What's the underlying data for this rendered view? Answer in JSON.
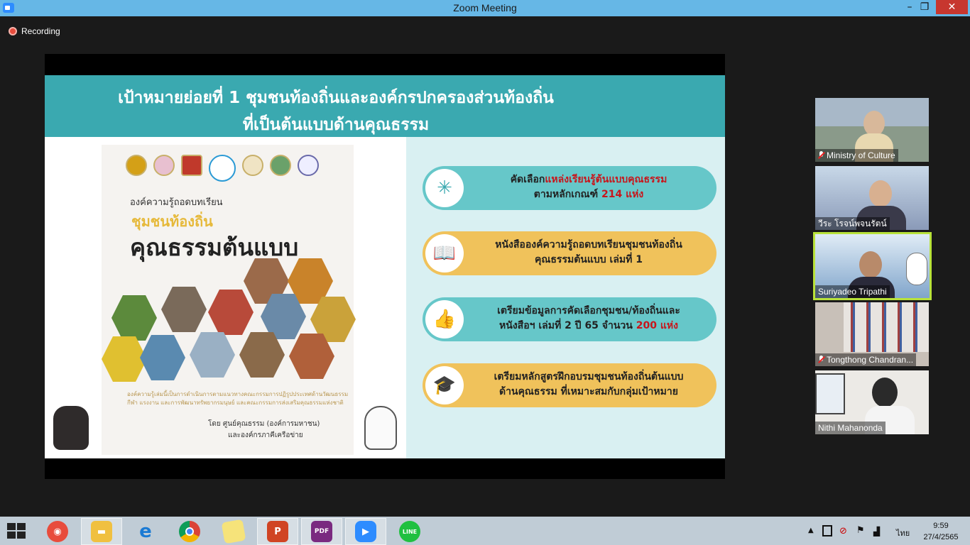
{
  "window": {
    "title": "Zoom Meeting",
    "minimize": "–",
    "maximize": "❐",
    "close": "✕"
  },
  "recording": {
    "label": "Recording"
  },
  "slide": {
    "title_line1": "เป้าหมายย่อยที่ 1 ชุมชนท้องถิ่นและองค์กรปกครองส่วนท้องถิ่น",
    "title_line2": "ที่เป็นต้นแบบด้านคุณธรรม",
    "book": {
      "kicker": "องค์ความรู้ถอดบทเรียน",
      "subtitle": "ชุมชนท้องถิ่น",
      "title": "คุณธรรมต้นแบบ",
      "footnote": "องค์ความรู้เล่มนี้เป็นการดำเนินการตามแนวทางคณะกรรมการปฏิรูปประเทศด้านวัฒนธรรม กีฬา แรงงาน และการพัฒนาทรัพยากรมนุษย์ และคณะกรรมการส่งเสริมคุณธรรมแห่งชาติ",
      "by_line1": "โดย ศูนย์คุณธรรม (องค์การมหาชน)",
      "by_line2": "และองค์กรภาคีเครือข่าย"
    },
    "items": [
      {
        "icon": "network-icon",
        "line1_pre": "คัดเลือก",
        "line1_red": "แหล่งเรียนรู้ต้นแบบคุณธรรม",
        "line2_pre": "ตามหลักเกณฑ์ ",
        "line2_red": "214 แห่ง"
      },
      {
        "icon": "book-icon",
        "line1": "หนังสือองค์ความรู้ถอดบทเรียนชุมชนท้องถิ่น",
        "line2": "คุณธรรมต้นแบบ เล่มที่ 1"
      },
      {
        "icon": "thumbs-up-icon",
        "line1": "เตรียมข้อมูลการคัดเลือกชุมชน/ท้องถิ่นและ",
        "line2_pre": "หนังสือฯ เล่มที่ 2 ปี 65 จำนวน ",
        "line2_red": "200 แห่ง"
      },
      {
        "icon": "graduation-cap-icon",
        "line1": "เตรียมหลักสูตรฝึกอบรมชุมชนท้องถิ่นต้นแบบ",
        "line2": "ด้านคุณธรรม ที่เหมาะสมกับกลุ่มเป้าหมาย"
      }
    ]
  },
  "participants": [
    {
      "name": "Ministry of Culture",
      "muted": true
    },
    {
      "name": "วีระ โรจน์พจนรัตน์",
      "muted": false
    },
    {
      "name": "Suriyadeo Tripathi",
      "muted": false,
      "active": true
    },
    {
      "name": "Tongthong Chandran...",
      "muted": true
    },
    {
      "name": "Nithi Mahanonda",
      "muted": false
    }
  ],
  "taskbar": {
    "apps": [
      "start-icon",
      "browser-pinned-icon",
      "file-explorer-icon",
      "internet-explorer-icon",
      "chrome-icon",
      "sticky-notes-icon",
      "powerpoint-icon",
      "pdf-icon",
      "zoom-icon",
      "line-icon"
    ],
    "pdf_label": "PDF",
    "line_label": "LINE",
    "language": "ไทย",
    "time": "9:59",
    "date": "27/4/2565"
  },
  "colors": {
    "titlebar": "#66b7e6",
    "header_teal": "#3aa9b0",
    "pill_teal": "#66c7c9",
    "pill_orange": "#f0c25b",
    "accent_red": "#c8151b"
  }
}
